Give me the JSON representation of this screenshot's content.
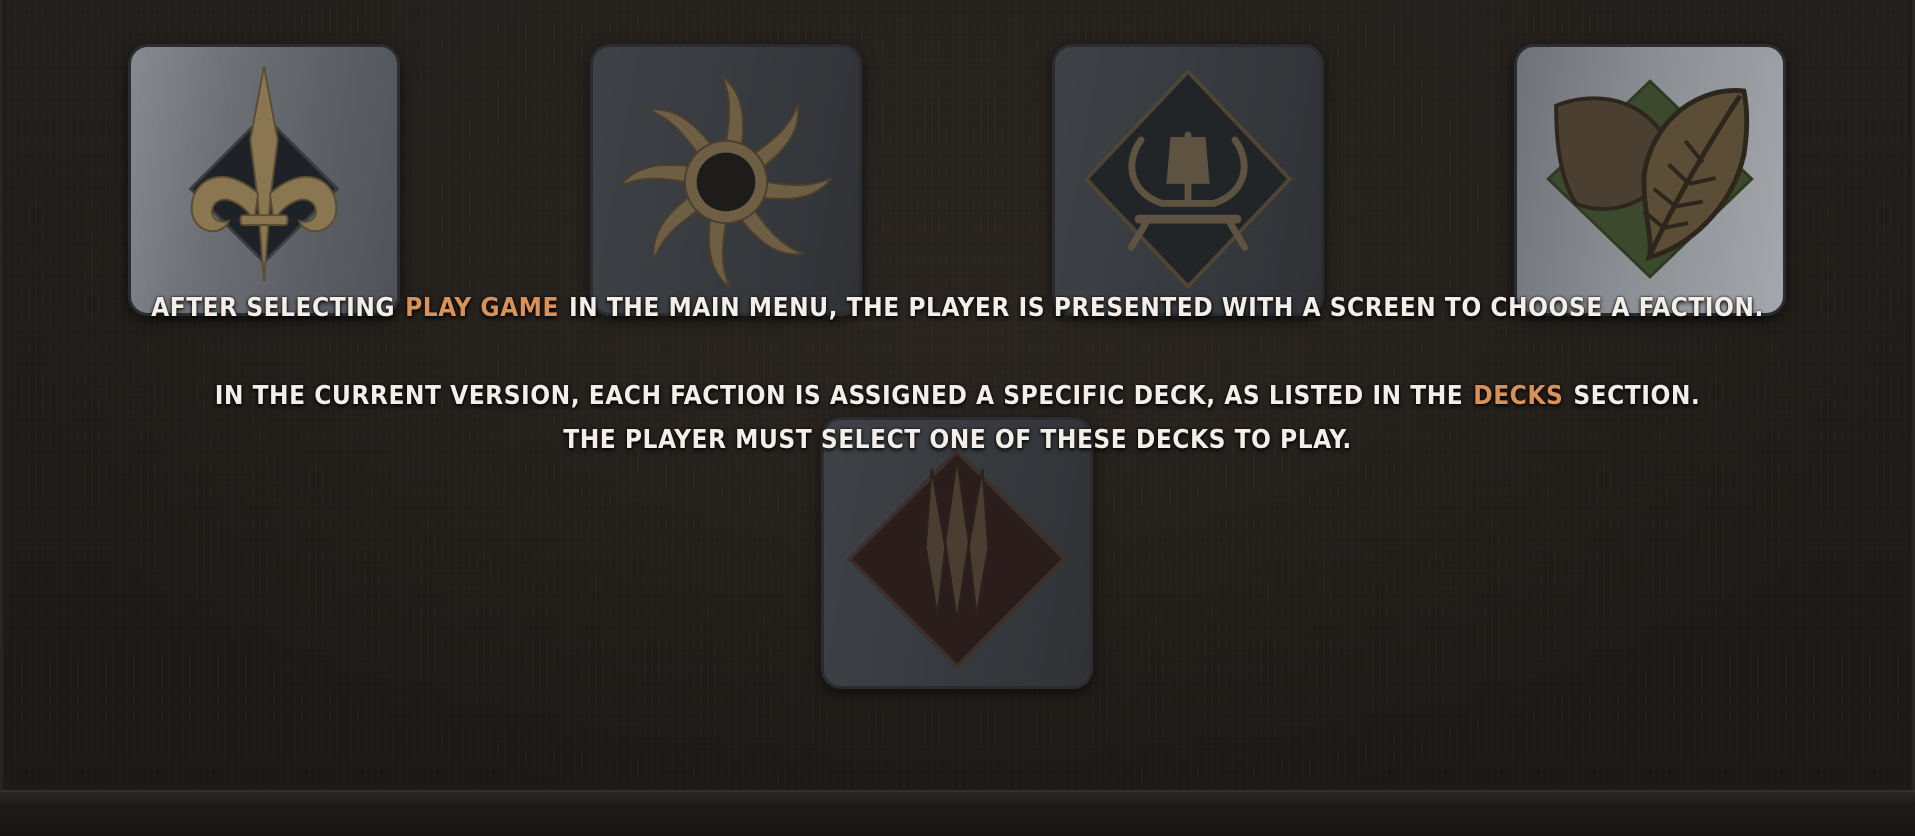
{
  "intro": {
    "part1": "After selecting",
    "highlight_play_game": "Play Game",
    "part2": "in the main menu, the player is presented with a screen to choose a faction."
  },
  "decks_note": {
    "part1": "In the current version, each faction is assigned a specific deck, as listed in the",
    "highlight_decks": "Decks",
    "part2": "section."
  },
  "select_note": "The player must select one of these decks to play.",
  "factions": [
    {
      "icon": "fleur-de-lis-icon"
    },
    {
      "icon": "black-sun-icon"
    },
    {
      "icon": "longship-icon"
    },
    {
      "icon": "leaf-icon"
    },
    {
      "icon": "claw-marks-icon"
    }
  ],
  "colors": {
    "highlight": "#d9915a",
    "text": "#f3efe8",
    "emblem_gold": "#8a7752",
    "background": "#1e1b18"
  }
}
